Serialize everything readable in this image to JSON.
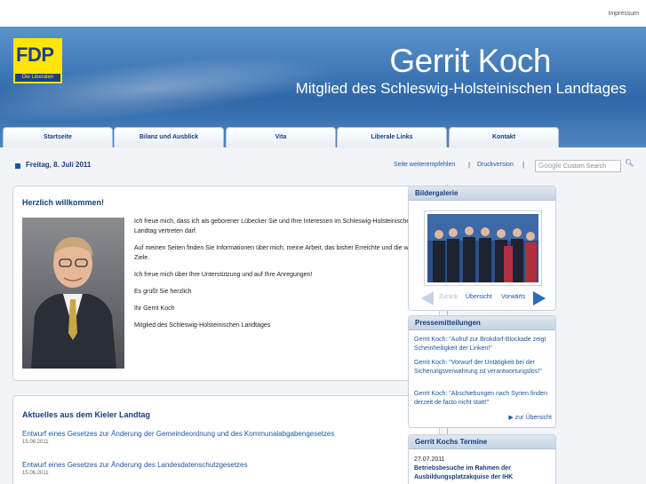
{
  "topbar": {
    "impressum": "Impressum"
  },
  "header": {
    "logo_text": "FDP",
    "logo_sub": "Die Liberalen",
    "name": "Gerrit Koch",
    "subtitle": "Mitglied des Schleswig-Holsteinischen Landtages"
  },
  "nav": {
    "tabs": [
      {
        "label": "Startseite"
      },
      {
        "label": "Bilanz und Ausblick"
      },
      {
        "label": "Vita"
      },
      {
        "label": "Liberale Links"
      },
      {
        "label": "Kontakt"
      }
    ]
  },
  "toolbar": {
    "date": "Freitag, 8. Juli 2011",
    "recommend": "Seite weiterempfehlen",
    "print": "Druckversion",
    "search_brand": "Google",
    "search_placeholder": "Custom Search"
  },
  "welcome": {
    "title": "Herzlich willkommen!",
    "paragraphs": [
      "Ich freue mich, dass ich als geborener Lübecker Sie und Ihre Interessen im Schleswig-Holsteinischen Landtag vertreten darf.",
      "Auf meinen Seiten finden Sie Informationen über mich, meine Arbeit, das bisher Erreichte und die weiteren Ziele.",
      "Ich freue mich über Ihre Unterstützung und auf Ihre Anregungen!",
      "Es grüßt Sie herzlich",
      "Ihr Gerrit Koch",
      "Mitglied des Schleswig-Holsteinischen Landtages"
    ]
  },
  "news": {
    "title": "Aktuelles aus dem Kieler Landtag",
    "items": [
      {
        "title": "Entwurf eines Gesetzes zur Änderung der Gemeindeordnung und des Kommunalabgabengesetzes",
        "date": "15.06.2011"
      },
      {
        "title": "Entwurf eines Gesetzes zur Änderung des Landesdatenschutzgesetzes",
        "date": "15.06.2011"
      }
    ]
  },
  "gallery": {
    "title": "Bildergalerie",
    "back": "Zurück",
    "overview": "Übersicht",
    "next": "Vorwärts"
  },
  "press": {
    "title": "Pressemitteilungen",
    "items": [
      "Gerrit Koch: \"Aufruf zur Brokdorf-Blockade zeigt Scheinheiligkeit der Linken!\"",
      "Gerrit Koch: \"Vorwurf der Untätigkeit bei der Sicherungsverwahrung ist verantwortungslos!\"",
      "Gerrit Koch: \"Abschiebungen nach Syrien finden derzeit de facto nicht statt!\""
    ],
    "more": "zur Übersicht"
  },
  "events": {
    "title": "Gerrit Kochs Termine",
    "date": "27.07.2011",
    "text": "Betriebsbesuche im Rahmen der Ausbildungsplatzakquise der IHK"
  }
}
